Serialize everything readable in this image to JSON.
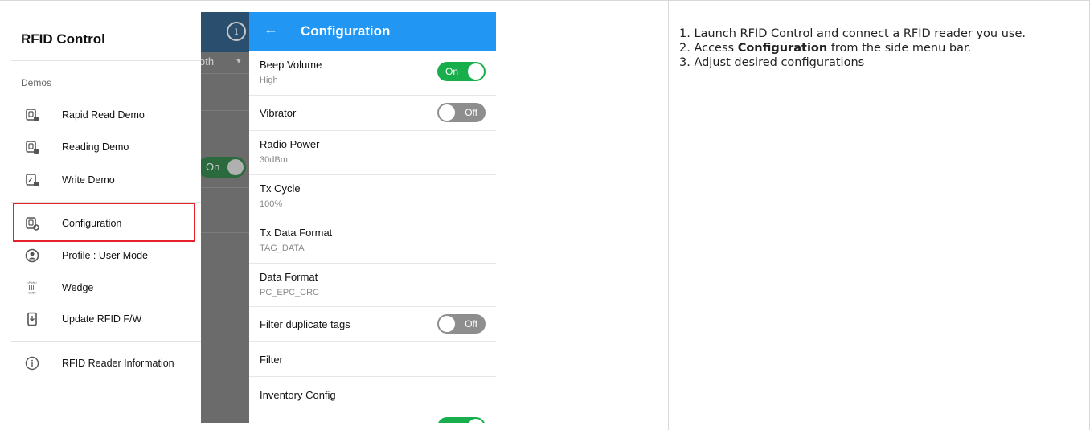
{
  "drawer": {
    "title": "RFID Control",
    "section_label": "Demos",
    "items": [
      {
        "label": "Rapid Read Demo",
        "icon": "rfid-card-icon"
      },
      {
        "label": "Reading Demo",
        "icon": "rfid-card-icon"
      },
      {
        "label": "Write Demo",
        "icon": "rfid-card-edit-icon"
      },
      {
        "label": "Configuration",
        "icon": "rfid-settings-icon"
      },
      {
        "label": "Profile : User Mode",
        "icon": "user-circle-icon"
      },
      {
        "label": "Wedge",
        "icon": "barcode-prefix-suffix-icon",
        "icon_text_top": "<Prefix>",
        "icon_text_bottom": "<Suffix>"
      },
      {
        "label": "Update RFID F/W",
        "icon": "phone-download-icon"
      },
      {
        "label": "RFID Reader Information",
        "icon": "info-circle-icon"
      }
    ],
    "highlight_color": "#e5212a"
  },
  "background": {
    "select_text": "oth",
    "toggle_label": "On"
  },
  "config": {
    "title": "Configuration",
    "back_icon": "arrow-left-icon",
    "accent": "#2196f3",
    "settings": [
      {
        "title": "Beep Volume",
        "sub": "High",
        "toggle": "On"
      },
      {
        "title": "Vibrator",
        "toggle": "Off"
      },
      {
        "title": "Radio Power",
        "sub": "30dBm"
      },
      {
        "title": "Tx Cycle",
        "sub": "100%"
      },
      {
        "title": "Tx Data Format",
        "sub": "TAG_DATA"
      },
      {
        "title": "Data Format",
        "sub": "PC_EPC_CRC"
      },
      {
        "title": "Filter duplicate tags",
        "toggle": "Off"
      },
      {
        "title": "Filter"
      },
      {
        "title": "Inventory Config"
      }
    ],
    "toggle_on_color": "#19ae4c",
    "toggle_off_color": "#8e8e8e"
  },
  "instructions": {
    "step1": "1. Launch RFID Control and connect a RFID reader you use.",
    "step2_pre": "2. Access ",
    "step2_bold": "Configuration",
    "step2_post": " from the side menu bar.",
    "step3": "3. Adjust desired configurations"
  }
}
